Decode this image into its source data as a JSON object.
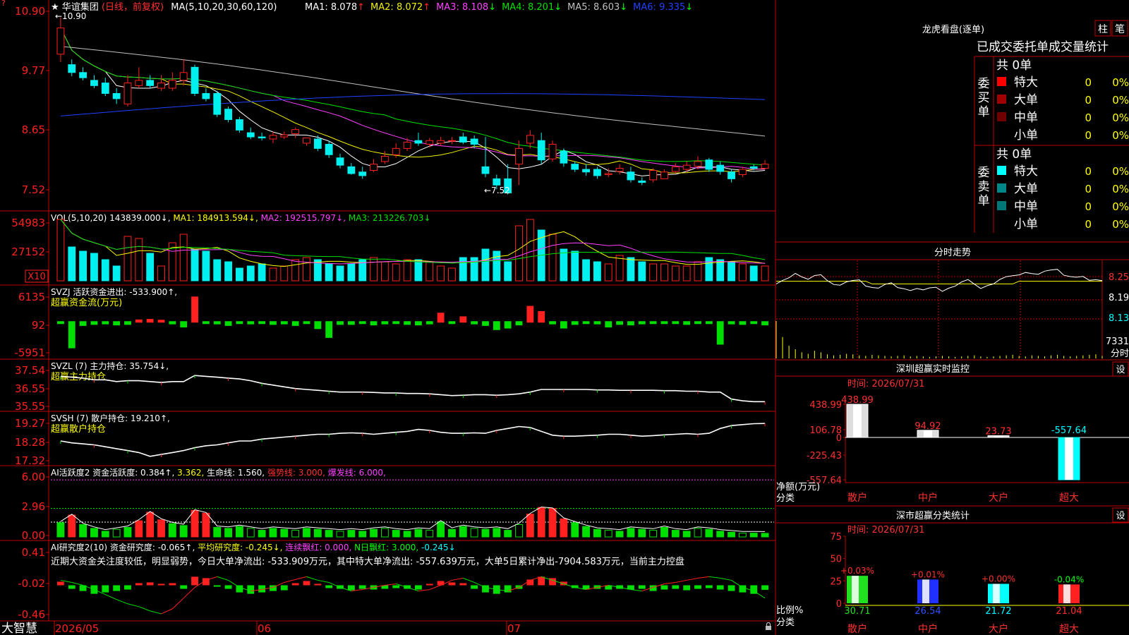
{
  "app": {
    "name": "大智慧",
    "stock_name": "华谊集团",
    "period_tag": "(日线，前复权)"
  },
  "colors": {
    "up": "#ff2020",
    "down": "#00f0f0",
    "border": "#d00000",
    "ma1": "#ffffff",
    "ma2": "#f0f000",
    "ma3": "#ff40ff",
    "ma4": "#00e000",
    "ma5": "#c0c0c0",
    "ma6": "#2040ff"
  },
  "main_panel": {
    "ma_title": "MA(5,10,20,30,60,120)",
    "ma_values": [
      {
        "label": "MA1:",
        "value": "8.078",
        "arrow": "↑"
      },
      {
        "label": "MA2:",
        "value": "8.072",
        "arrow": "↑"
      },
      {
        "label": "MA3:",
        "value": "8.108",
        "arrow": "↓"
      },
      {
        "label": "MA4:",
        "value": "8.201",
        "arrow": "↓"
      },
      {
        "label": "MA5:",
        "value": "8.603",
        "arrow": "↓"
      },
      {
        "label": "MA6:",
        "value": "9.335",
        "arrow": "↓"
      }
    ],
    "y_ticks": [
      "10.90",
      "9.77",
      "8.65",
      "7.52"
    ],
    "high_marker": "←10.90",
    "low_marker": "←7.52"
  },
  "x_axis": {
    "labels": [
      "2026/05",
      "06",
      "07"
    ]
  },
  "chart_data": [
    {
      "type": "candlestick",
      "name": "price",
      "ylim": [
        7.3,
        11.1
      ],
      "open": [
        10.2,
        10.0,
        9.85,
        9.7,
        9.65,
        9.45,
        9.25,
        9.6,
        9.7,
        9.55,
        9.55,
        9.7,
        9.95,
        9.45,
        9.45,
        9.15,
        8.95,
        8.7,
        8.62,
        8.58,
        8.62,
        8.68,
        8.5,
        8.58,
        8.48,
        8.22,
        8.05,
        7.95,
        7.98,
        8.15,
        8.28,
        8.4,
        8.55,
        8.48,
        8.5,
        8.55,
        8.62,
        8.58,
        8.05,
        7.82,
        7.82,
        8.1,
        8.5,
        8.55,
        8.2,
        8.35,
        8.1,
        8.0,
        8.0,
        7.9,
        7.96,
        7.95,
        7.78,
        7.8,
        7.82,
        7.96,
        8.0,
        8.06,
        8.18,
        8.08,
        7.95,
        7.9,
        8.05,
        8.02
      ],
      "close": [
        10.7,
        9.85,
        9.75,
        9.6,
        9.45,
        9.35,
        9.65,
        9.7,
        9.6,
        9.65,
        9.7,
        9.85,
        9.45,
        9.35,
        9.05,
        8.95,
        8.75,
        8.62,
        8.6,
        8.65,
        8.66,
        8.76,
        8.6,
        8.4,
        8.28,
        8.08,
        7.92,
        7.88,
        8.1,
        8.25,
        8.4,
        8.52,
        8.5,
        8.55,
        8.55,
        8.55,
        8.52,
        8.48,
        7.92,
        7.7,
        7.55,
        8.4,
        8.65,
        8.18,
        8.48,
        8.12,
        8.0,
        7.95,
        7.88,
        7.92,
        8.02,
        7.8,
        7.75,
        7.98,
        7.95,
        8.05,
        8.08,
        8.15,
        8.0,
        7.96,
        7.82,
        8.0,
        8.02,
        8.1
      ],
      "high": [
        10.9,
        10.1,
        9.95,
        9.8,
        9.75,
        9.55,
        9.8,
        9.95,
        9.8,
        9.8,
        9.85,
        10.1,
        10.0,
        9.55,
        9.5,
        9.2,
        9.0,
        8.8,
        8.7,
        8.72,
        8.72,
        8.8,
        8.6,
        8.65,
        8.55,
        8.3,
        8.12,
        8.05,
        8.2,
        8.35,
        8.5,
        8.6,
        8.7,
        8.6,
        8.62,
        8.62,
        8.7,
        8.65,
        8.62,
        7.9,
        8.1,
        8.55,
        8.75,
        8.7,
        8.55,
        8.4,
        8.15,
        8.1,
        8.05,
        8.02,
        8.1,
        8.05,
        7.85,
        8.02,
        8.0,
        8.12,
        8.15,
        8.25,
        8.22,
        8.15,
        8.0,
        8.05,
        8.1,
        8.18
      ],
      "low": [
        10.05,
        9.78,
        9.7,
        9.55,
        9.4,
        9.25,
        9.2,
        9.55,
        9.55,
        9.5,
        9.5,
        9.6,
        9.4,
        9.3,
        9.0,
        8.9,
        8.7,
        8.58,
        8.55,
        8.5,
        8.58,
        8.6,
        8.45,
        8.35,
        8.22,
        8.02,
        7.9,
        7.82,
        7.95,
        8.1,
        8.22,
        8.35,
        8.45,
        8.42,
        8.45,
        8.48,
        8.48,
        8.4,
        7.85,
        7.62,
        7.52,
        7.7,
        8.4,
        8.1,
        8.15,
        8.05,
        7.95,
        7.88,
        7.82,
        7.85,
        7.9,
        7.75,
        7.7,
        7.75,
        7.85,
        7.92,
        7.95,
        8.0,
        7.95,
        7.9,
        7.75,
        7.85,
        7.98,
        8.0
      ]
    },
    {
      "type": "bar",
      "name": "VOL",
      "title": "VOL(5,10,20)",
      "values_text": [
        "143839.000↓,",
        "MA1: 184913.594↓,",
        "MA2: 192515.797↓,",
        "MA3: 213226.703↓"
      ],
      "y_ticks": [
        "54983",
        "27152",
        "X10"
      ],
      "ylim": [
        0,
        62000
      ],
      "values": [
        58000,
        32000,
        28000,
        26000,
        20000,
        14000,
        42000,
        40000,
        26000,
        14000,
        36000,
        44000,
        30000,
        28000,
        20000,
        18000,
        12000,
        14000,
        16000,
        12000,
        14000,
        20000,
        22000,
        20000,
        16000,
        14000,
        16000,
        20000,
        22000,
        18000,
        16000,
        20000,
        20000,
        18000,
        14000,
        12000,
        22000,
        22000,
        30000,
        28000,
        18000,
        52000,
        58000,
        48000,
        44000,
        30000,
        28000,
        20000,
        18000,
        16000,
        24000,
        22000,
        18000,
        16000,
        16000,
        14000,
        14000,
        18000,
        22000,
        20000,
        18000,
        16000,
        14000,
        14000
      ]
    },
    {
      "type": "bar",
      "name": "SVZJ",
      "title": "SVZJ",
      "caption": "活跃资金进出: -533.900↑,",
      "subtitle": "超赢资金流(万元)",
      "y_ticks": [
        "6135",
        "92",
        "-5951"
      ],
      "ylim": [
        -6200,
        6400
      ],
      "values": [
        -300,
        -5200,
        -900,
        -700,
        -600,
        -800,
        -700,
        600,
        700,
        500,
        -600,
        -1200,
        5000,
        -400,
        -600,
        -900,
        -500,
        -600,
        -400,
        -700,
        -600,
        -900,
        -500,
        -1500,
        -3200,
        -700,
        -700,
        -400,
        -800,
        -600,
        -500,
        -700,
        -800,
        -600,
        1900,
        -300,
        1200,
        -600,
        -900,
        -1700,
        -1400,
        -800,
        3200,
        2200,
        -600,
        -1400,
        -700,
        -400,
        -600,
        -1200,
        -700,
        -800,
        -600,
        -500,
        -400,
        -500,
        -700,
        -500,
        -400,
        -4500,
        -600,
        -700,
        -500,
        -800
      ]
    },
    {
      "type": "line",
      "name": "SVZL",
      "title": "SVZL (7)",
      "caption": "主力持仓: 35.754↓,",
      "subtitle": "超赢主力持仓",
      "y_ticks": [
        "37.54",
        "36.55",
        "35.55"
      ],
      "ylim": [
        35.4,
        37.7
      ],
      "values": [
        37.2,
        37.15,
        37.1,
        37.0,
        37.0,
        36.9,
        36.95,
        36.95,
        36.9,
        36.85,
        36.9,
        36.9,
        37.25,
        37.2,
        37.15,
        37.1,
        37.05,
        36.95,
        36.8,
        36.7,
        36.6,
        36.5,
        36.45,
        36.4,
        36.35,
        36.3,
        36.3,
        36.3,
        36.28,
        36.25,
        36.25,
        36.22,
        36.22,
        36.2,
        36.15,
        36.1,
        36.12,
        36.15,
        36.15,
        36.12,
        36.15,
        36.2,
        36.3,
        36.45,
        36.45,
        36.45,
        36.45,
        36.45,
        36.42,
        36.42,
        36.4,
        36.4,
        36.4,
        36.4,
        36.38,
        36.38,
        36.35,
        36.35,
        36.3,
        36.3,
        35.9,
        35.8,
        35.75,
        35.75
      ]
    },
    {
      "type": "line",
      "name": "SVSH",
      "title": "SVSH (7)",
      "caption": "散户持仓: 19.210↑,",
      "subtitle": "超赢散户持仓",
      "y_ticks": [
        "19.27",
        "18.28",
        "17.32"
      ],
      "ylim": [
        17.2,
        19.4
      ],
      "values": [
        18.3,
        18.2,
        18.15,
        18.1,
        18.0,
        17.9,
        17.8,
        17.7,
        17.5,
        17.6,
        17.7,
        17.8,
        17.95,
        18.05,
        18.1,
        18.2,
        18.3,
        18.3,
        18.4,
        18.45,
        18.5,
        18.55,
        18.6,
        18.65,
        18.65,
        18.7,
        18.72,
        18.7,
        18.65,
        18.7,
        18.75,
        18.8,
        18.9,
        18.85,
        18.75,
        18.7,
        18.7,
        18.72,
        18.7,
        18.85,
        18.95,
        19.05,
        19.0,
        18.8,
        18.6,
        18.55,
        18.55,
        18.58,
        18.6,
        18.65,
        18.65,
        18.6,
        18.55,
        18.58,
        18.62,
        18.65,
        18.68,
        18.65,
        18.7,
        18.95,
        19.1,
        19.15,
        19.2,
        19.21
      ]
    },
    {
      "type": "bar",
      "name": "AI活跃度",
      "title": "AI活跃度2",
      "caption_parts": [
        "资金活跃度: 0.384↑,",
        "3.362,",
        "生命线: 1.560,",
        "强势线: 3.000,",
        "爆发线: 6.000,"
      ],
      "y_ticks": [
        "6.00",
        "2.96",
        "0.00"
      ],
      "ylim": [
        0,
        6.6
      ],
      "values": [
        1.5,
        2.3,
        1.3,
        0.9,
        0.6,
        0.8,
        1.0,
        1.7,
        2.6,
        1.8,
        1.4,
        1.2,
        2.8,
        2.5,
        1.0,
        0.9,
        1.1,
        0.9,
        0.7,
        0.9,
        0.8,
        0.7,
        0.9,
        0.8,
        0.7,
        0.6,
        0.7,
        0.6,
        0.8,
        0.9,
        0.7,
        0.6,
        0.8,
        0.7,
        1.6,
        0.8,
        1.1,
        0.9,
        0.8,
        0.9,
        0.7,
        1.3,
        2.4,
        3.1,
        3.0,
        1.9,
        1.5,
        1.1,
        0.8,
        0.7,
        0.6,
        0.9,
        0.8,
        0.7,
        1.0,
        0.7,
        0.6,
        0.9,
        0.8,
        0.6,
        0.5,
        0.4,
        0.4,
        0.38
      ]
    },
    {
      "type": "bar",
      "name": "AI研究度",
      "title": "AI研究度2(10)",
      "caption_parts": [
        "资金研究度: -0.065↑,",
        "平均研究度: -0.245↓,",
        "连续飘红: 0.000,",
        "N日飘红: 3.000,",
        "-0.245↓"
      ],
      "commentary": "近期大资金关注度较低，明显弱势，今日大单净流出: -533.909万元，其中特大单净流出: -557.639万元，大单5日累计净出-7904.583万元，当前主力控盘",
      "y_ticks": [
        "0.41",
        "-0.02",
        "-0.46"
      ],
      "ylim": [
        -0.48,
        0.45
      ],
      "values": [
        0.05,
        -0.05,
        -0.08,
        -0.12,
        -0.1,
        -0.08,
        -0.06,
        0.03,
        0.04,
        0.02,
        0.03,
        -0.05,
        0.12,
        0.1,
        -0.02,
        -0.05,
        -0.1,
        -0.12,
        -0.1,
        -0.08,
        -0.07,
        0.03,
        0.06,
        0.02,
        -0.04,
        -0.05,
        -0.07,
        -0.05,
        -0.06,
        -0.05,
        -0.04,
        -0.05,
        -0.06,
        0.02,
        0.06,
        0.04,
        0.03,
        -0.05,
        -0.1,
        -0.12,
        -0.1,
        -0.05,
        0.08,
        0.12,
        0.1,
        0.05,
        -0.04,
        -0.06,
        -0.05,
        -0.06,
        -0.05,
        -0.06,
        -0.05,
        -0.08,
        -0.06,
        -0.05,
        -0.07,
        -0.05,
        -0.04,
        -0.06,
        -0.08,
        -0.1,
        -0.12,
        -0.065
      ],
      "line": [
        0.05,
        0.02,
        -0.02,
        -0.08,
        -0.15,
        -0.22,
        -0.28,
        -0.32,
        -0.38,
        -0.42,
        -0.35,
        -0.2,
        -0.05,
        0.05,
        0.1,
        0.05,
        -0.05,
        -0.1,
        -0.08,
        -0.05,
        0.02,
        0.06,
        0.1,
        0.05,
        0.02,
        -0.05,
        -0.1,
        -0.08,
        -0.05,
        -0.02,
        0.0,
        -0.05,
        -0.1,
        -0.08,
        -0.02,
        0.05,
        0.08,
        0.02,
        -0.05,
        -0.08,
        -0.1,
        -0.05,
        0.05,
        0.1,
        0.05,
        0.0,
        -0.05,
        -0.08,
        -0.05,
        -0.02,
        -0.05,
        -0.08,
        -0.1,
        -0.05,
        0.0,
        0.02,
        0.05,
        0.08,
        0.1,
        0.08,
        0.05,
        -0.05,
        -0.1,
        -0.2
      ]
    }
  ],
  "side": {
    "lhb_title": "龙虎看盘(逐单)",
    "lhb_tabs": [
      "柱",
      "笔"
    ],
    "lhb_table_title": "已成交委托单成交量统计",
    "buy": {
      "label": "委买单",
      "total": "共 0单",
      "rows": [
        {
          "name": "特大",
          "count": "0",
          "pct": "0%",
          "color": "#ff0000"
        },
        {
          "name": "大单",
          "count": "0",
          "pct": "0%",
          "color": "#a00000"
        },
        {
          "name": "中单",
          "count": "0",
          "pct": "0%",
          "color": "#700000"
        },
        {
          "name": "小单",
          "count": "0",
          "pct": "0%",
          "color": "#000000"
        }
      ]
    },
    "sell": {
      "label": "委卖单",
      "total": "共 0单",
      "rows": [
        {
          "name": "特大",
          "count": "0",
          "pct": "0%",
          "color": "#00ffff"
        },
        {
          "name": "大单",
          "count": "0",
          "pct": "0%",
          "color": "#008888"
        },
        {
          "name": "中单",
          "count": "0",
          "pct": "0%",
          "color": "#007777"
        },
        {
          "name": "小单",
          "count": "0",
          "pct": "0%",
          "color": "#000000"
        }
      ]
    },
    "intraday": {
      "title": "分时走势",
      "price_ticks": [
        "8.25",
        "8.19",
        "8.13"
      ],
      "vol_tick": "7331",
      "vol_label": "分时",
      "ylim": [
        8.1,
        8.3
      ],
      "price": [
        8.22,
        8.24,
        8.25,
        8.26,
        8.24,
        8.23,
        8.25,
        8.26,
        8.24,
        8.22,
        8.21,
        8.22,
        8.23,
        8.24,
        8.22,
        8.21,
        8.2,
        8.21,
        8.22,
        8.21,
        8.21,
        8.2,
        8.2,
        8.19,
        8.2,
        8.21,
        8.2,
        8.21,
        8.21,
        8.22,
        8.23,
        8.22,
        8.21,
        8.22,
        8.22,
        8.23,
        8.24,
        8.25,
        8.26,
        8.27,
        8.26,
        8.25,
        8.26,
        8.27,
        8.28,
        8.26,
        8.25,
        8.24,
        8.24,
        8.23,
        8.24,
        8.24
      ],
      "avg": [
        8.23,
        8.23,
        8.23,
        8.23,
        8.23,
        8.23,
        8.23,
        8.23,
        8.23,
        8.23,
        8.23,
        8.23,
        8.23,
        8.23,
        8.23,
        8.22,
        8.22,
        8.22,
        8.22,
        8.22,
        8.22,
        8.22,
        8.22,
        8.22,
        8.22,
        8.22,
        8.22,
        8.22,
        8.22,
        8.22,
        8.22,
        8.22,
        8.22,
        8.22,
        8.22,
        8.22,
        8.22,
        8.22,
        8.23,
        8.23,
        8.23,
        8.23,
        8.23,
        8.23,
        8.23,
        8.23,
        8.23,
        8.23,
        8.23,
        8.23,
        8.23,
        8.23
      ],
      "volume": [
        7331,
        4200,
        2500,
        1800,
        1200,
        900,
        1500,
        1200,
        800,
        600,
        700,
        900,
        800,
        600,
        500,
        700,
        600,
        500,
        400,
        500,
        600,
        400,
        500,
        400,
        300,
        400,
        500,
        400,
        300,
        400,
        500,
        600,
        400,
        300,
        400,
        500,
        600,
        700,
        500,
        400,
        600,
        500,
        400,
        600,
        700,
        500,
        400,
        500,
        600,
        700,
        800,
        500
      ]
    },
    "sz_monitor": {
      "title": "深圳超赢实时监控",
      "btn": "设",
      "time": "时间: 2026/07/31",
      "y_ticks": [
        "438.99",
        "106.78",
        "0",
        "-225.43",
        "-557.64"
      ],
      "y_label_1": "净额(万元)",
      "y_label_2": "分类",
      "categories": [
        "散户",
        "中户",
        "大户",
        "超大"
      ],
      "value_labels": [
        "438.99",
        "94.92",
        "23.73",
        "-557.64"
      ],
      "values": [
        438.99,
        94.92,
        23.73,
        -557.64
      ],
      "ylim": [
        -557.64,
        438.99
      ]
    },
    "sz_stats": {
      "title": "深市超赢分类统计",
      "btn": "设",
      "time": "时间: 2026/07/31",
      "y_ticks": [
        "75",
        "50",
        "25",
        "0"
      ],
      "y_label_1": "比例%",
      "y_label_2": "分类",
      "categories": [
        "散户",
        "中户",
        "大户",
        "超大"
      ],
      "changes": [
        "+0.03%",
        "+0.01%",
        "+0.00%",
        "-0.04%"
      ],
      "values": [
        30.71,
        26.54,
        21.72,
        21.04
      ],
      "value_labels": [
        "30.71",
        "26.54",
        "21.72",
        "21.04"
      ],
      "colors": [
        "#20e020",
        "#2030ff",
        "#00ffff",
        "#ff2020"
      ],
      "ylim": [
        0,
        75
      ]
    }
  }
}
